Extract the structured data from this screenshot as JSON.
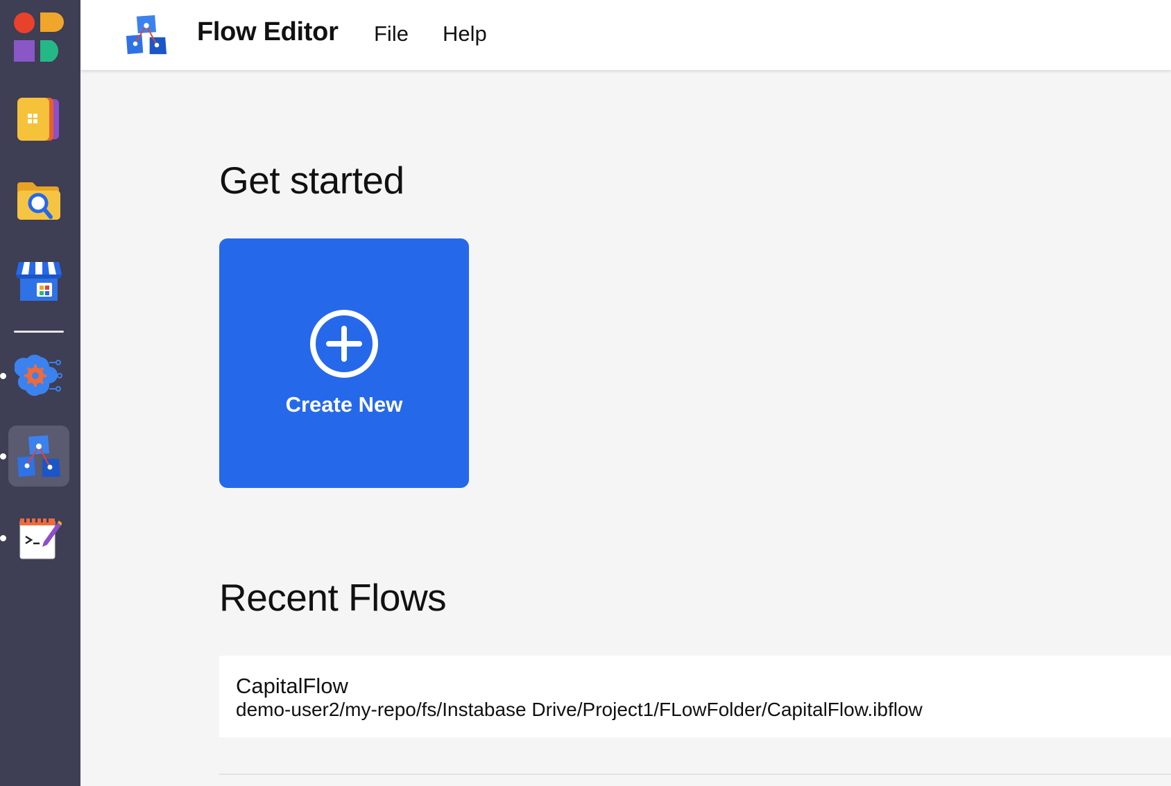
{
  "header": {
    "title": "Flow Editor",
    "menu": [
      {
        "label": "File"
      },
      {
        "label": "Help"
      }
    ]
  },
  "rail": {
    "items": [
      {
        "icon": "app-grid-icon"
      },
      {
        "icon": "solutions-hub-icon"
      },
      {
        "icon": "file-explorer-icon"
      },
      {
        "icon": "marketplace-icon"
      },
      {
        "icon": "ml-studio-icon",
        "running": true
      },
      {
        "icon": "flow-editor-icon",
        "running": true,
        "active": true
      },
      {
        "icon": "notebook-icon",
        "running": true
      }
    ]
  },
  "main": {
    "get_started_title": "Get started",
    "create_new_label": "Create New",
    "recent_title": "Recent Flows",
    "recent_flows": [
      {
        "name": "CapitalFlow",
        "path": "demo-user2/my-repo/fs/Instabase Drive/Project1/FLowFolder/CapitalFlow.ibflow"
      }
    ]
  },
  "colors": {
    "rail_bg": "#3e3e54",
    "accent": "#2569ea",
    "page_bg": "#f5f5f5"
  }
}
